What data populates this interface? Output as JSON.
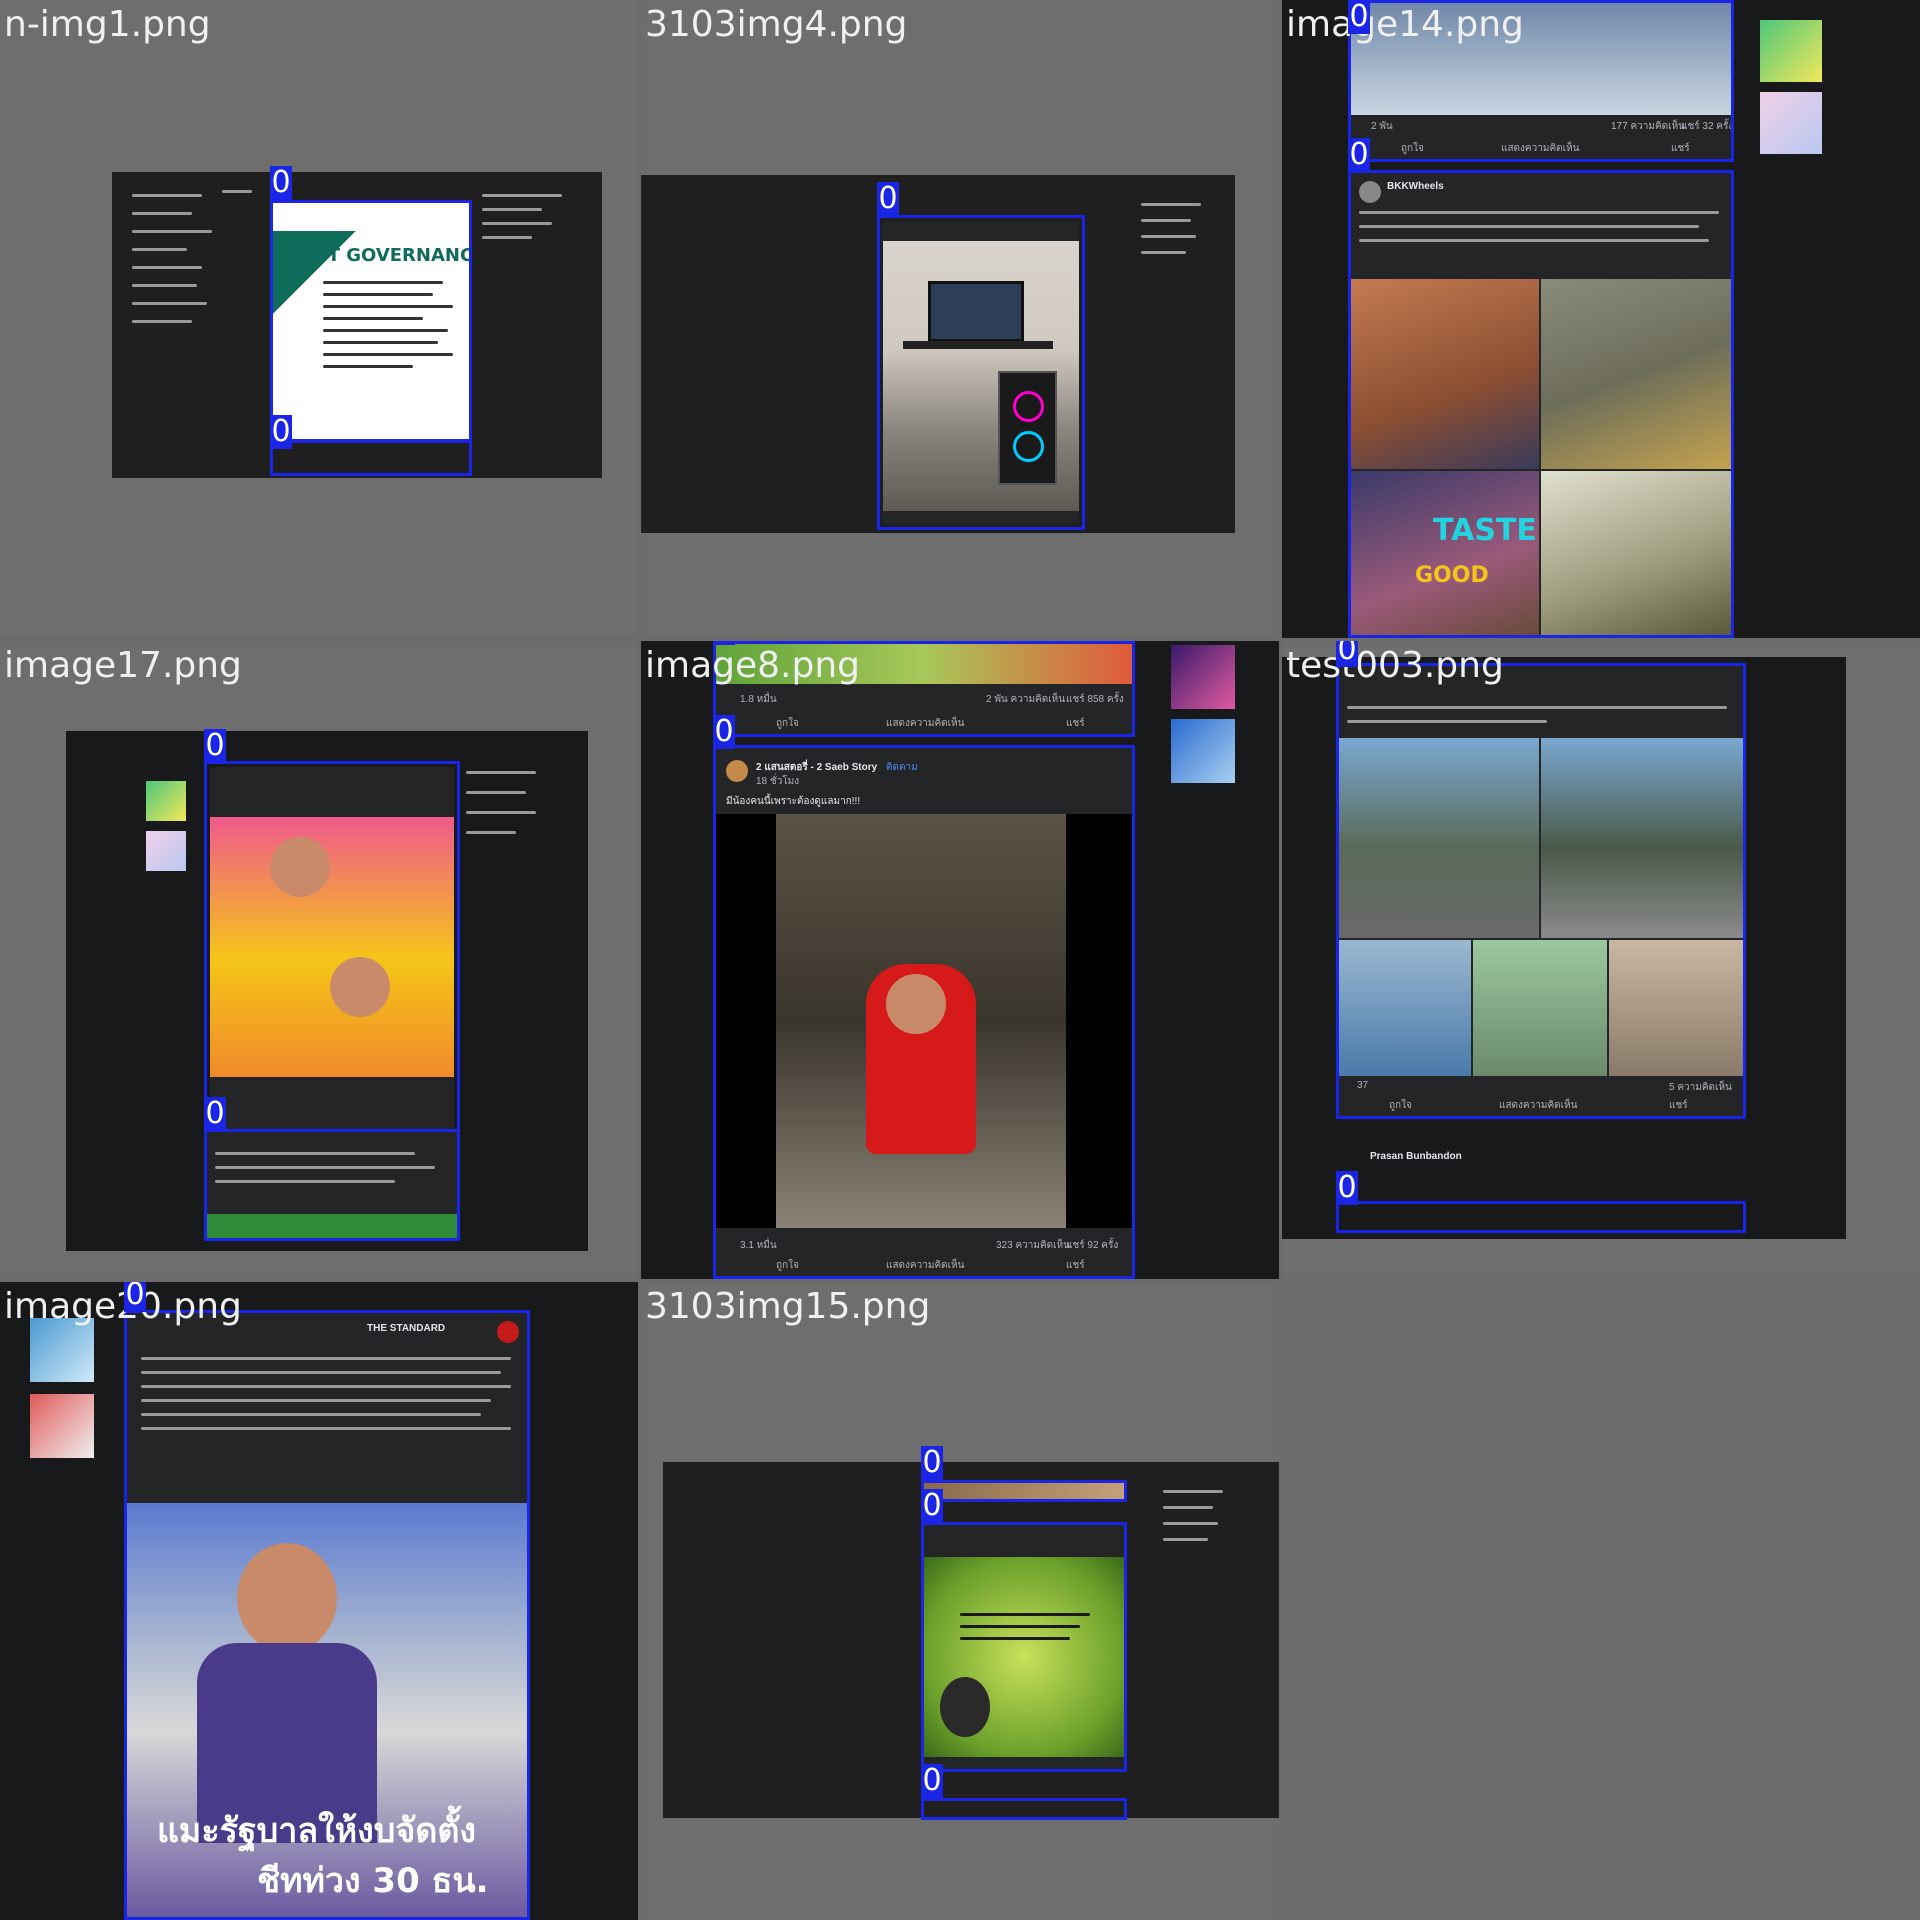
{
  "tiles": [
    {
      "filename": "n-img1.png",
      "poster": "IT GOVERNANCE"
    },
    {
      "filename": "3103img4.png"
    },
    {
      "filename": "image14.png",
      "post_author": "BKKWheels",
      "reactions": "2 พัน",
      "comments": "177 ความคิดเห็น",
      "shares": "แชร์ 32 ครั้ง",
      "overlay1": "TASTE",
      "overlay2": "GOOD"
    },
    {
      "filename": "image17.png"
    },
    {
      "filename": "image8.png",
      "page": "2 แสนสตอรี่ - 2 Saeb Story",
      "follow": "ติดตาม",
      "time": "18 ชั่วโมง",
      "text": "มีน้องคนนี้เพราะต้องดูแลมาก!!!",
      "top_reactions": "1.8 หมื่น",
      "top_comments": "2 พัน ความคิดเห็น",
      "top_shares": "แชร์ 858 ครั้ง",
      "bot_reactions": "3.1 หมื่น",
      "bot_comments": "323 ความคิดเห็น",
      "bot_shares": "แชร์ 92 ครั้ง"
    },
    {
      "filename": "test003.png",
      "reactions": "37",
      "comments": "5 ความคิดเห็น",
      "commenter": "Prasan Bunbandon"
    },
    {
      "filename": "image20.png",
      "page": "THE STANDARD",
      "overlay1": "แมะรัฐบาลให้งบจัดตั้ง",
      "overlay2": "ชีทท่วง 30 ธน."
    },
    {
      "filename": "3103img15.png"
    }
  ],
  "actions": {
    "like": "ถูกใจ",
    "comment": "แสดงความคิดเห็น",
    "share": "แชร์"
  },
  "badge_label": "0",
  "colors": {
    "box": "#1a25e6",
    "fb_dark": "#242526",
    "bg": "#6b6b6b"
  }
}
